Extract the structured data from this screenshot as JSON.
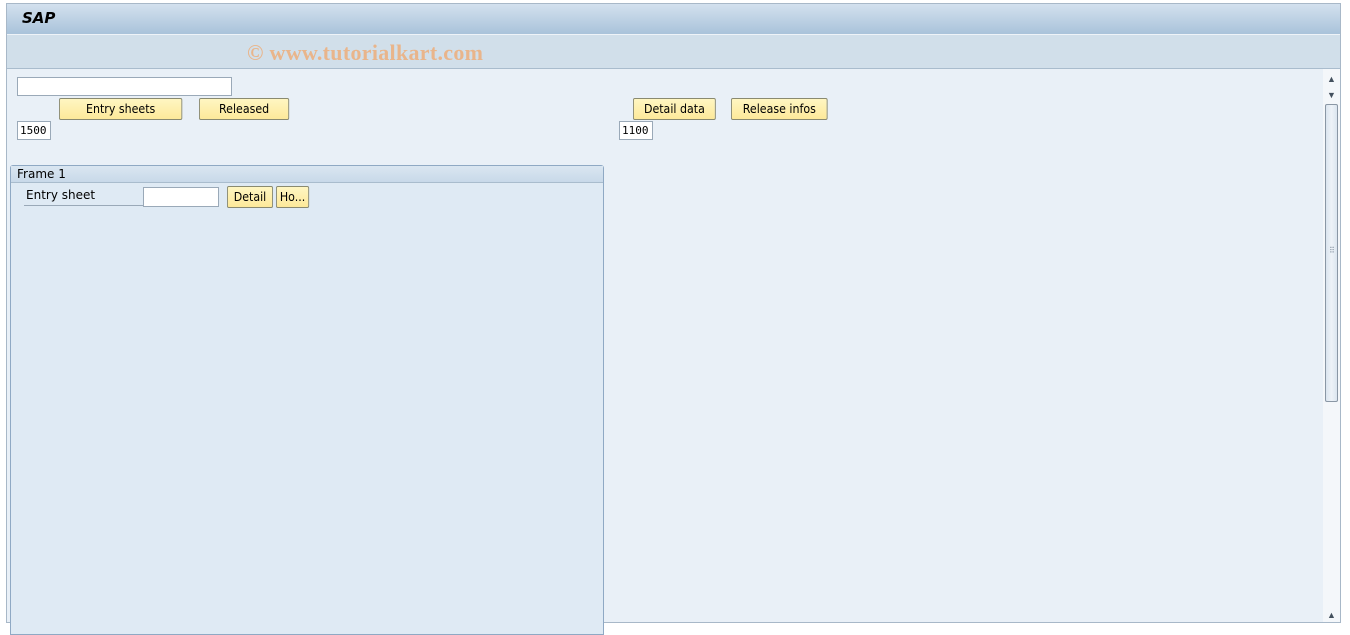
{
  "window": {
    "title": "SAP",
    "watermark": "© www.tutorialkart.com"
  },
  "header_area": {
    "top_input": {
      "value": "",
      "placeholder": ""
    },
    "left_buttons": [
      {
        "label": "Entry sheets"
      },
      {
        "label": "Released"
      }
    ],
    "right_buttons": [
      {
        "label": "Detail data"
      },
      {
        "label": "Release infos"
      }
    ],
    "left_value": "1500",
    "right_value": "1100"
  },
  "frame": {
    "title": "Frame 1",
    "entry_sheet_label": "Entry sheet",
    "entry_sheet_value": "",
    "detail_button": "Detail",
    "ho_button": "Ho..."
  },
  "scrollbar": {
    "up_icon": "▲",
    "down_icon": "▼",
    "grip_icon": "⠿"
  }
}
